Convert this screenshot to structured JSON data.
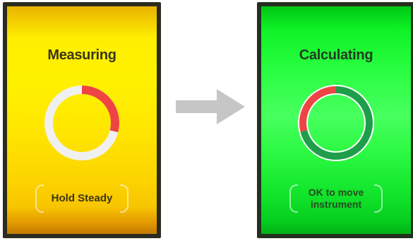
{
  "left_screen": {
    "title": "Measuring",
    "status": "Hold Steady",
    "ring": {
      "progress_fraction": 0.29,
      "track_color": "#f0f0f0",
      "progress_color": "#ef4444"
    },
    "background": "#fff200"
  },
  "right_screen": {
    "title": "Calculating",
    "status_line1": "OK to move",
    "status_line2": "instrument",
    "ring": {
      "green_fraction": 0.71,
      "red_fraction": 0.29,
      "green_color": "#1e9e4a",
      "red_color": "#ef4444"
    },
    "background": "#2cff44"
  },
  "arrow": {
    "icon": "right-arrow-icon",
    "color": "#c6c6c6"
  }
}
